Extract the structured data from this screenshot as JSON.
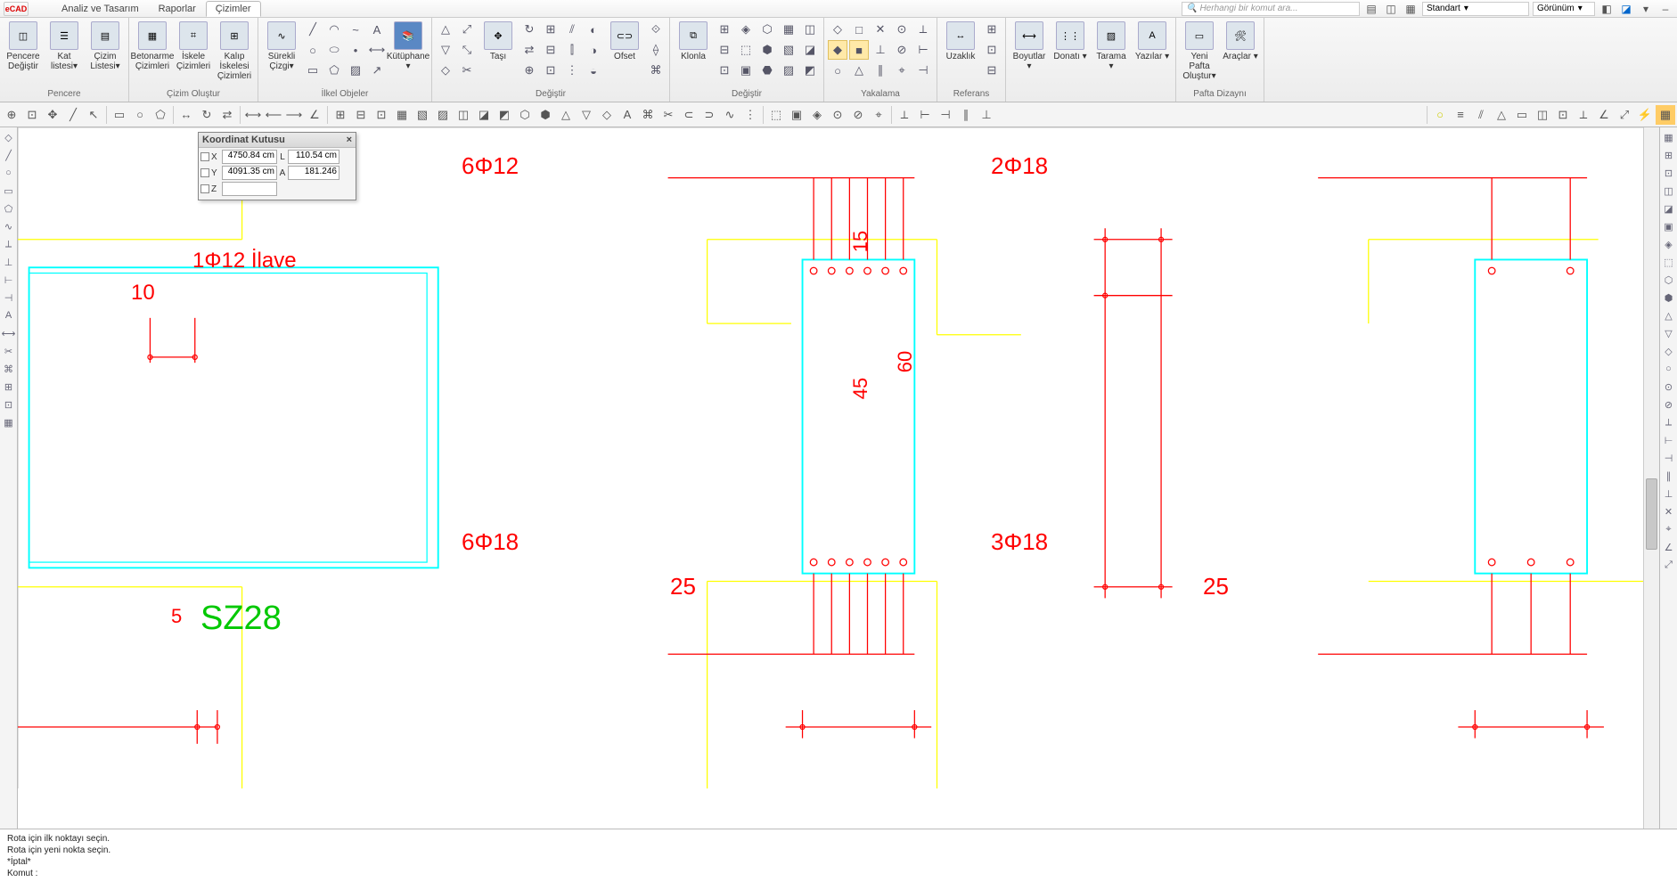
{
  "logo": "eCAD",
  "menu_tabs": [
    "Analiz ve Tasarım",
    "Raporlar",
    "Çizimler"
  ],
  "menu_tabs_active": 2,
  "search_placeholder": "Herhangi bir komut ara...",
  "style_dropdown": "Standart",
  "view_dropdown": "Görünüm",
  "ribbon": {
    "groups": [
      {
        "label": "Pencere",
        "large": [
          {
            "lbl": "Pencere Değiştir"
          },
          {
            "lbl": "Kat listesi▾"
          },
          {
            "lbl": "Çizim Listesi▾"
          }
        ]
      },
      {
        "label": "Çizim Oluştur",
        "large": [
          {
            "lbl": "Betonarme Çizimleri"
          },
          {
            "lbl": "İskele Çizimleri"
          },
          {
            "lbl": "Kalıp İskelesi Çizimleri"
          }
        ]
      },
      {
        "label": "İlkel Objeler",
        "large": [
          {
            "lbl": "Sürekli Çizgi▾"
          },
          {
            "lbl": ""
          },
          {
            "lbl": "Kütüphane ▾"
          }
        ],
        "small_cols": 4
      },
      {
        "label": "Değiştir",
        "large": [
          {
            "lbl": ""
          },
          {
            "lbl": "Taşı"
          },
          {
            "lbl": ""
          },
          {
            "lbl": "Ofset"
          }
        ],
        "small_cols": 8
      },
      {
        "label": "Değiştir",
        "large": [
          {
            "lbl": "Klonla"
          }
        ],
        "small_cols": 6
      },
      {
        "label": "Yakalama",
        "small_cols": 5
      },
      {
        "label": "Referans",
        "large": [
          {
            "lbl": "Uzaklık"
          }
        ],
        "small_cols": 2
      },
      {
        "label": "",
        "large": [
          {
            "lbl": "Boyutlar ▾"
          },
          {
            "lbl": "Donatı ▾"
          },
          {
            "lbl": "Tarama ▾"
          },
          {
            "lbl": "Yazılar ▾"
          }
        ]
      },
      {
        "label": "Pafta Dizaynı",
        "large": [
          {
            "lbl": "Yeni Pafta Oluştur▾"
          },
          {
            "lbl": "Araçlar ▾"
          }
        ]
      }
    ]
  },
  "coord_box": {
    "title": "Koordinat Kutusu",
    "rows": [
      {
        "axis": "X",
        "val": "4750.84 cm",
        "lbl2": "L",
        "val2": "110.54 cm"
      },
      {
        "axis": "Y",
        "val": "4091.35 cm",
        "lbl2": "A",
        "val2": "181.246"
      },
      {
        "axis": "Z",
        "val": "",
        "lbl2": "",
        "val2": ""
      }
    ]
  },
  "cmd_lines": [
    "Rota için ilk noktayı seçin.",
    "Rota için yeni nokta seçin.",
    "*İptal*",
    "Komut :"
  ],
  "drawing": {
    "sz28": "SZ28",
    "ilave": "1Φ12 İlave",
    "d10": "10",
    "d5": "5",
    "r6_12": "6Φ12",
    "r6_18": "6Φ18",
    "r2_18": "2Φ18",
    "r3_18": "3Φ18",
    "d25a": "25",
    "d25b": "25",
    "d15": "15",
    "d45": "45",
    "d60": "60"
  }
}
